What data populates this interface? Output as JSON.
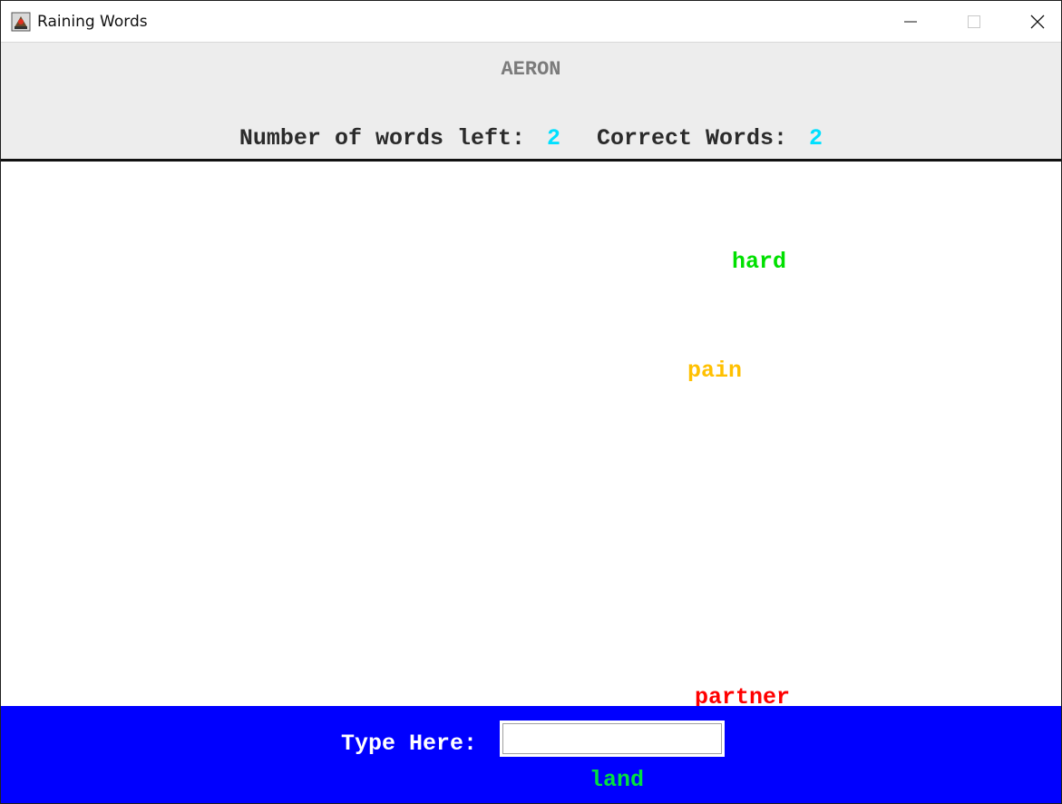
{
  "window": {
    "title": "Raining Words",
    "app_icon": "java-app-icon",
    "controls": [
      "minimize-icon",
      "maximize-icon",
      "close-icon"
    ]
  },
  "header": {
    "player_name": "AERON",
    "words_left_label": "Number of words left:",
    "words_left_value": "2",
    "correct_label": "Correct Words:",
    "correct_value": "2"
  },
  "falling_words": [
    {
      "text": "hard",
      "color": "#00e000"
    },
    {
      "text": "pain",
      "color": "#ffc000"
    },
    {
      "text": "partner",
      "color": "#ff0000"
    }
  ],
  "footer": {
    "type_label": "Type Here:",
    "input_value": "",
    "last_word": "land",
    "last_word_color": "#00e040"
  },
  "colors": {
    "header_bg": "#ededed",
    "footer_bg": "#0000ff",
    "stat_value": "#00e0ff"
  }
}
